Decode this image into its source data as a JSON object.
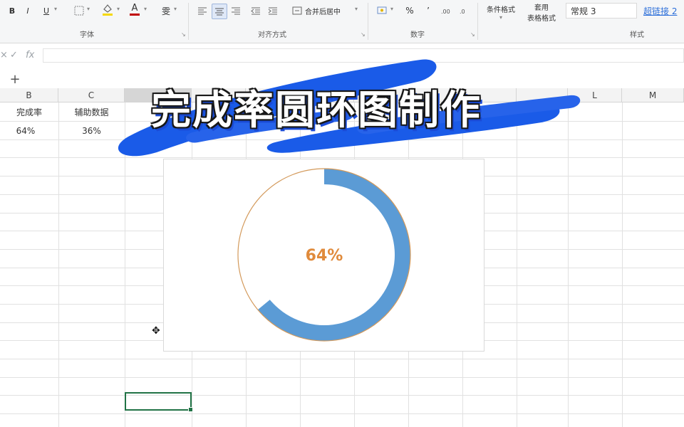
{
  "ribbon": {
    "font_group_label": "字体",
    "align_group_label": "对齐方式",
    "number_group_label": "数字",
    "styles_group_label": "样式",
    "bold": "B",
    "italic": "I",
    "underline": "U",
    "font_color_glyph": "A",
    "wen_glyph": "雯",
    "merge_label": "合并后居中",
    "percent": "%",
    "thousands": "’",
    "cond_format_label": "条件格式",
    "table_format_label_1": "套用",
    "table_format_label_2": "表格格式",
    "style_normal": "常规 3",
    "style_hyperlink": "超链接 2",
    "font_color_hex": "#c00000",
    "fill_color_hex": "#f5d800"
  },
  "formula_bar": {
    "cancel_glyph": "×",
    "confirm_glyph": "✓",
    "fx_label": "fx",
    "value": ""
  },
  "sheet_bar": {
    "add_glyph": "+"
  },
  "columns": {
    "headers": [
      "B",
      "C",
      "",
      "",
      "",
      "",
      "",
      "",
      "",
      "",
      "L",
      "M"
    ],
    "selected_index": 2
  },
  "cells": {
    "b_header": "完成率",
    "c_header": "辅助数据",
    "b_value": "64%",
    "c_value": "36%"
  },
  "chart_data": {
    "type": "pie",
    "variant": "doughnut",
    "categories": [
      "完成率",
      "辅助数据"
    ],
    "values": [
      64,
      36
    ],
    "center_label": "64%",
    "colors": [
      "#5b9bd5",
      "#ffffff"
    ],
    "outline_color": "#d3995a",
    "label_color": "#e08a3b"
  },
  "banner": {
    "title": "完成率圆环图制作",
    "brush_color": "#1a5be8"
  }
}
